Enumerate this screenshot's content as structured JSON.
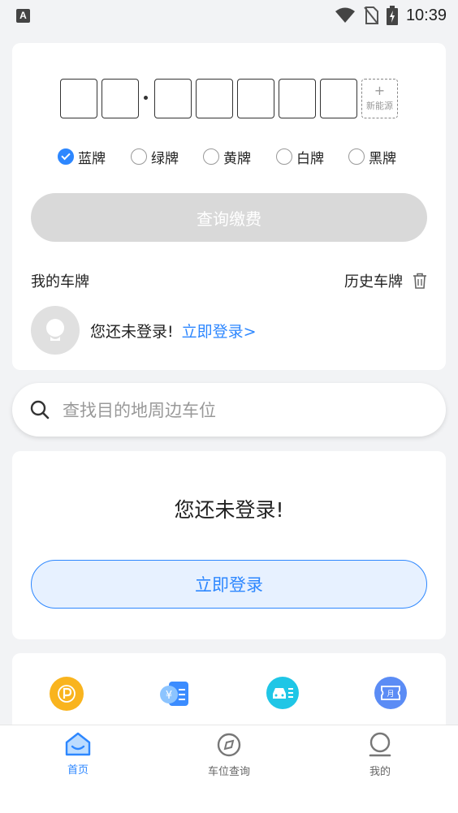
{
  "status_bar": {
    "left_icon": "A",
    "time": "10:39",
    "icons": [
      "wifi-icon",
      "no-sim-icon",
      "battery-charging-icon"
    ]
  },
  "plate": {
    "new_energy_plus": "+",
    "new_energy_label": "新能源",
    "colors": [
      {
        "label": "蓝牌",
        "checked": true
      },
      {
        "label": "绿牌",
        "checked": false
      },
      {
        "label": "黄牌",
        "checked": false
      },
      {
        "label": "白牌",
        "checked": false
      },
      {
        "label": "黑牌",
        "checked": false
      }
    ],
    "query_button": "查询缴费",
    "my_plates": "我的车牌",
    "history_plates": "历史车牌",
    "not_logged_in": "您还未登录!",
    "login_link": "立即登录>"
  },
  "search": {
    "placeholder": "查找目的地周边车位"
  },
  "login_card": {
    "title": "您还未登录!",
    "button": "立即登录"
  },
  "services": [
    {
      "icon": "parking-icon",
      "color": "#f9b41e"
    },
    {
      "icon": "payment-record-icon",
      "color": "#3b8cff"
    },
    {
      "icon": "car-list-icon",
      "color": "#1fc6e6"
    },
    {
      "icon": "monthly-ticket-icon",
      "color": "#5b8cf5"
    }
  ],
  "nav": {
    "home": "首页",
    "spot_query": "车位查询",
    "mine": "我的"
  },
  "colors": {
    "accent": "#2d87ff",
    "background": "#f2f3f5"
  }
}
